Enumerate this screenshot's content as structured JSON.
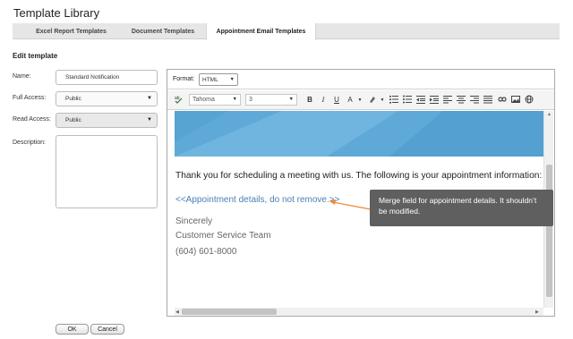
{
  "page": {
    "title": "Template Library"
  },
  "tabs": [
    {
      "label": "Excel Report Templates"
    },
    {
      "label": "Document Templates"
    },
    {
      "label": "Appointment Email Templates"
    }
  ],
  "form": {
    "section_title": "Edit template",
    "name_label": "Name:",
    "name_value": "Standard Notification",
    "full_access_label": "Full Access:",
    "full_access_value": "Public",
    "read_access_label": "Read Access:",
    "read_access_value": "Public",
    "description_label": "Description:"
  },
  "editor": {
    "format_label": "Format:",
    "format_value": "HTML",
    "font_value": "Tahoma",
    "size_value": "3",
    "toolbar_buttons": {
      "bold": "B",
      "italic": "I",
      "underline": "U",
      "font_color": "A"
    },
    "body": {
      "intro": "Thank you for scheduling a meeting with us. The following is your appointment information:",
      "merge_field": "<<Appointment details, do not remove.>>",
      "closing": "Sincerely",
      "team": "Customer Service Team",
      "phone": "(604) 601-8000"
    },
    "banner_colors": {
      "base": "#5fa9d8",
      "light": "#7cc0e6",
      "dark": "#4a97c9"
    }
  },
  "annotation": {
    "text": "Merge field for appointment details. It shouldn’t be modified.",
    "arrow_color": "#f0882f"
  },
  "buttons": {
    "ok": "OK",
    "cancel": "Cancel"
  }
}
